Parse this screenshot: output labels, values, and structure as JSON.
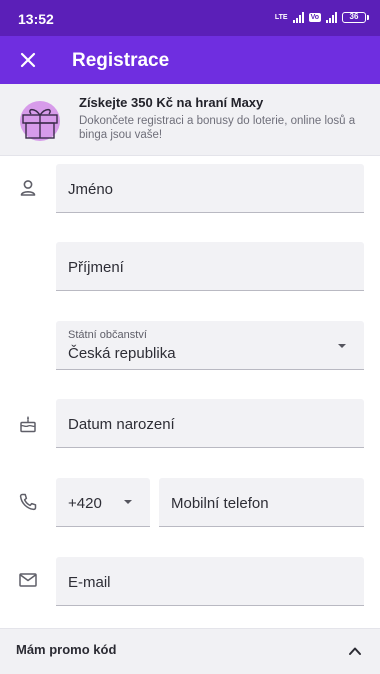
{
  "status_bar": {
    "time": "13:52",
    "network": "LTE",
    "volte": "Vo",
    "battery": "36"
  },
  "app_bar": {
    "title": "Registrace"
  },
  "promo_banner": {
    "title": "Získejte 350 Kč na hraní Maxy",
    "description": "Dokončete registraci a bonusy do loterie, online losů a binga jsou vaše!"
  },
  "form": {
    "first_name_placeholder": "Jméno",
    "last_name_placeholder": "Příjmení",
    "citizenship": {
      "label": "Státní občanství",
      "value": "Česká republika"
    },
    "birth_date_placeholder": "Datum narození",
    "phone_prefix": "+420",
    "phone_placeholder": "Mobilní telefon",
    "email_placeholder": "E-mail"
  },
  "promo_code": {
    "label": "Mám promo kód"
  },
  "colors": {
    "status_bar": "#5b1fb8",
    "app_bar": "#6f2ee0",
    "field_bg": "#f2f2f5",
    "gift_accent": "#d79bea"
  },
  "icons": [
    "close-icon",
    "gift-icon",
    "person-icon",
    "cake-icon",
    "phone-icon",
    "mail-icon",
    "chevron-up-icon",
    "dropdown-arrow-icon"
  ]
}
